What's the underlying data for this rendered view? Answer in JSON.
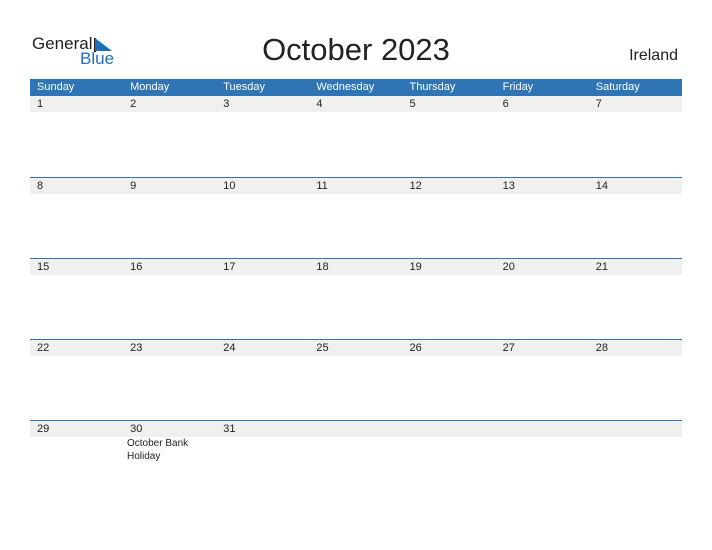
{
  "logo": {
    "general": "General",
    "blue": "Blue"
  },
  "title": "October 2023",
  "country": "Ireland",
  "weekdays": [
    "Sunday",
    "Monday",
    "Tuesday",
    "Wednesday",
    "Thursday",
    "Friday",
    "Saturday"
  ],
  "weeks": [
    [
      "1",
      "2",
      "3",
      "4",
      "5",
      "6",
      "7"
    ],
    [
      "8",
      "9",
      "10",
      "11",
      "12",
      "13",
      "14"
    ],
    [
      "15",
      "16",
      "17",
      "18",
      "19",
      "20",
      "21"
    ],
    [
      "22",
      "23",
      "24",
      "25",
      "26",
      "27",
      "28"
    ],
    [
      "29",
      "30",
      "31",
      "",
      "",
      "",
      ""
    ]
  ],
  "events": [
    {
      "date": "30",
      "label": "October Bank Holiday"
    }
  ],
  "colors": {
    "header": "#2f75b5",
    "brand_blue": "#1f6fb8",
    "date_row": "#f0f0f0"
  }
}
